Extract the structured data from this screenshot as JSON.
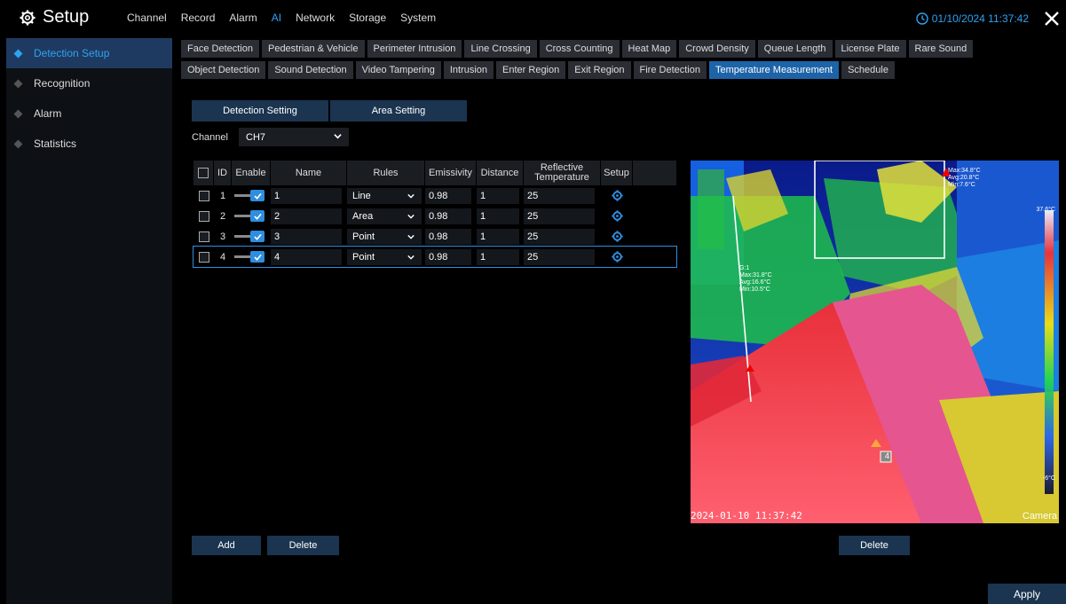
{
  "header": {
    "title": "Setup",
    "menu": [
      "Channel",
      "Record",
      "Alarm",
      "AI",
      "Network",
      "Storage",
      "System"
    ],
    "active_menu": "AI",
    "datetime": "01/10/2024 11:37:42",
    "accent": "#2ea3f2"
  },
  "sidebar": {
    "items": [
      {
        "label": "Detection Setup",
        "active": true
      },
      {
        "label": "Recognition"
      },
      {
        "label": "Alarm"
      },
      {
        "label": "Statistics"
      }
    ]
  },
  "tabs": {
    "row1": [
      "Face Detection",
      "Pedestrian & Vehicle",
      "Perimeter Intrusion",
      "Line Crossing",
      "Cross Counting",
      "Heat Map",
      "Crowd Density",
      "Queue Length",
      "License Plate",
      "Rare Sound"
    ],
    "row2": [
      "Object Detection",
      "Sound Detection",
      "Video Tampering",
      "Intrusion",
      "Enter Region",
      "Exit Region",
      "Fire Detection",
      "Temperature Measurement",
      "Schedule"
    ],
    "active": "Temperature Measurement"
  },
  "subtabs": [
    "Detection Setting",
    "Area Setting"
  ],
  "channel": {
    "label": "Channel",
    "value": "CH7"
  },
  "table": {
    "headers": {
      "id": "ID",
      "enable": "Enable",
      "name": "Name",
      "rules": "Rules",
      "emissivity": "Emissivity",
      "distance": "Distance",
      "reflective": "Reflective Temperature",
      "setup": "Setup"
    },
    "rows": [
      {
        "id": "1",
        "name": "1",
        "rule": "Line",
        "emissivity": "0.98",
        "distance": "1",
        "reflective": "25"
      },
      {
        "id": "2",
        "name": "2",
        "rule": "Area",
        "emissivity": "0.98",
        "distance": "1",
        "reflective": "25"
      },
      {
        "id": "3",
        "name": "3",
        "rule": "Point",
        "emissivity": "0.98",
        "distance": "1",
        "reflective": "25"
      },
      {
        "id": "4",
        "name": "4",
        "rule": "Point",
        "emissivity": "0.98",
        "distance": "1",
        "reflective": "25"
      }
    ]
  },
  "buttons": {
    "add": "Add",
    "delete": "Delete",
    "image_delete": "Delete",
    "apply": "Apply"
  },
  "preview": {
    "timestamp": "2024-01-10 11:37:42",
    "camera": "Camera",
    "point_marker": "4",
    "area_readout": [
      "Max:34.8°C",
      "Avg:20.8°C",
      "Min:7.6°C"
    ],
    "line_readout": [
      "G:1",
      "Max:31.8°C",
      "Avg:16.6°C",
      "Min:10.5°C"
    ],
    "scale_top": "37.6°C",
    "scale_bottom": "-6°C"
  }
}
